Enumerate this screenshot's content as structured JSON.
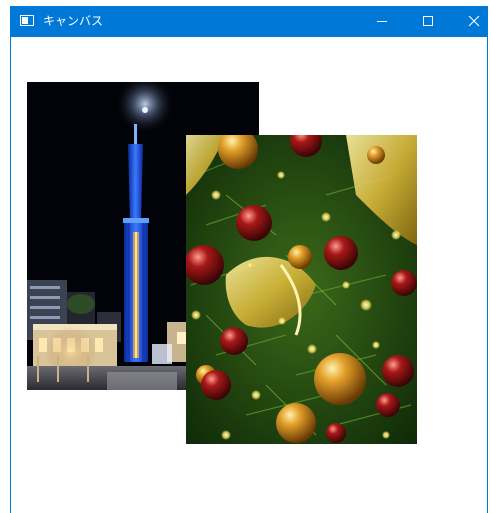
{
  "window": {
    "title": "キャンバス",
    "accent_color": "#0078d7",
    "app_icon": "window-app-icon",
    "controls": {
      "minimize_icon": "minimize-icon",
      "maximize_icon": "maximize-icon",
      "close_icon": "close-icon"
    }
  },
  "canvas": {
    "background": "#ffffff",
    "images": [
      {
        "subject": "illuminated-tower-night-photo"
      },
      {
        "subject": "christmas-tree-ornaments-photo"
      }
    ]
  }
}
